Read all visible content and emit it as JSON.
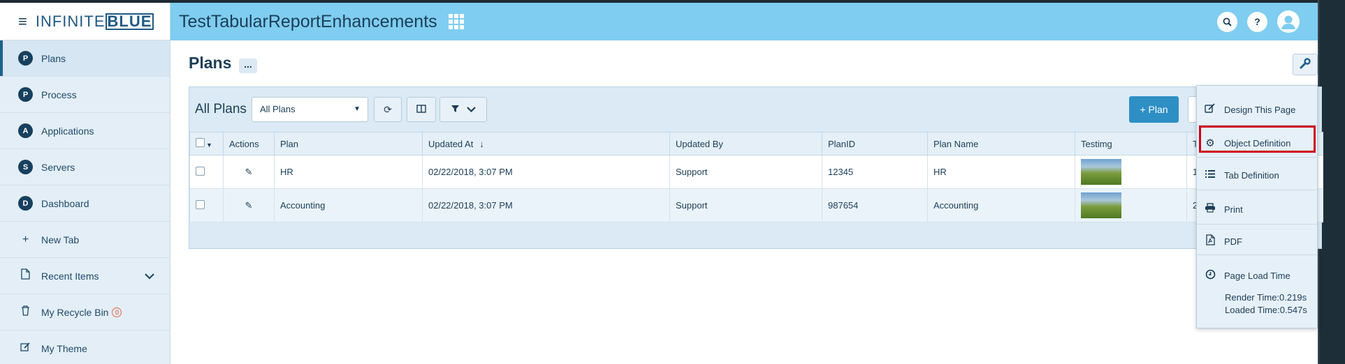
{
  "brand": {
    "logo_a": "INFINITE",
    "logo_b": "BLUE"
  },
  "header": {
    "app_title": "TestTabularReportEnhancements"
  },
  "sidebar": {
    "items": [
      {
        "label": "Plans",
        "letter": "P"
      },
      {
        "label": "Process",
        "letter": "P"
      },
      {
        "label": "Applications",
        "letter": "A"
      },
      {
        "label": "Servers",
        "letter": "S"
      },
      {
        "label": "Dashboard",
        "letter": "D"
      },
      {
        "label": "New Tab"
      },
      {
        "label": "Recent Items"
      },
      {
        "label": "My Recycle Bin",
        "badge": "0"
      },
      {
        "label": "My Theme"
      }
    ]
  },
  "page": {
    "title": "Plans",
    "more": "..."
  },
  "toolbar": {
    "view_label": "All Plans",
    "view_selected": "All Plans",
    "add_plan": "+ Plan"
  },
  "table": {
    "columns": [
      "Actions",
      "Plan",
      "Updated At",
      "Updated By",
      "PlanID",
      "Plan Name",
      "Testimg",
      "T"
    ],
    "rows": [
      {
        "plan": "HR",
        "updated_at": "02/22/2018, 3:07 PM",
        "updated_by": "Support",
        "plan_id": "12345",
        "plan_name": "HR",
        "extra": "1"
      },
      {
        "plan": "Accounting",
        "updated_at": "02/22/2018, 3:07 PM",
        "updated_by": "Support",
        "plan_id": "987654",
        "plan_name": "Accounting",
        "extra": "2"
      }
    ]
  },
  "menu": {
    "items": [
      {
        "label": "Design This Page",
        "icon": "edit-icon"
      },
      {
        "label": "Object Definition",
        "icon": "gears-icon"
      },
      {
        "label": "Tab Definition",
        "icon": "list-icon"
      },
      {
        "label": "Print",
        "icon": "print-icon"
      },
      {
        "label": "PDF",
        "icon": "pdf-icon"
      },
      {
        "label": "Page Load Time",
        "icon": "clock-icon"
      }
    ],
    "render_time": "Render Time:0.219s",
    "loaded_time": "Loaded Time:0.547s"
  },
  "colors": {
    "header": "#7fcdf0",
    "accent": "#2e8fc5",
    "highlight": "#d0021b"
  }
}
